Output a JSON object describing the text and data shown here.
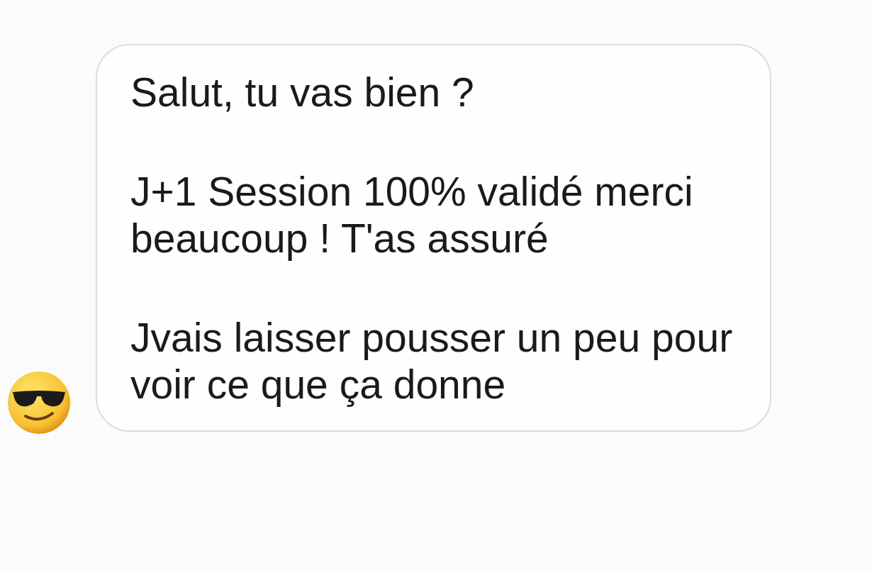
{
  "messages": [
    {
      "paragraphs": [
        "Salut, tu vas bien ?",
        "J+1 Session 100% validé merci beaucoup ! T'as assuré",
        "Jvais laisser pousser un peu pour voir ce que ça donne"
      ]
    }
  ]
}
